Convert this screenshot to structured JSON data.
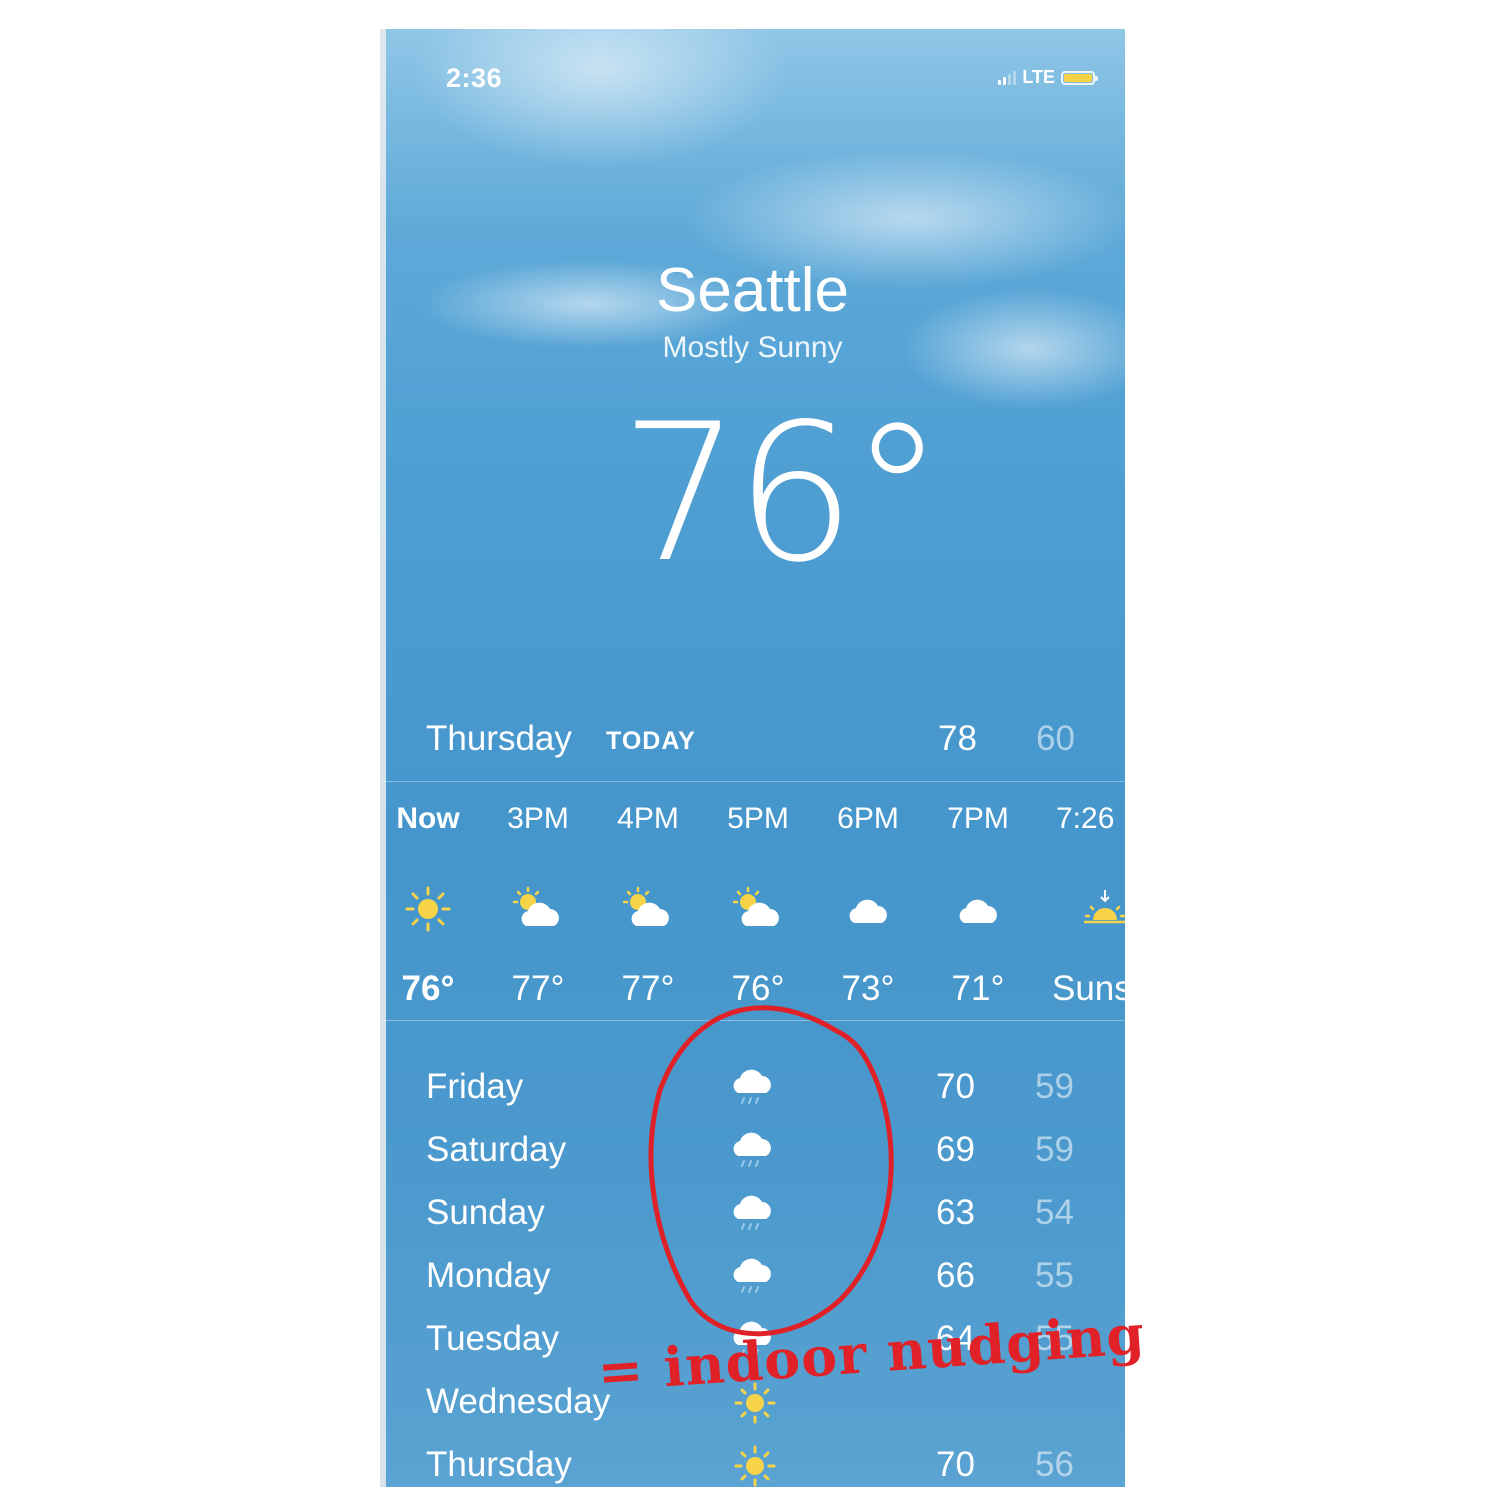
{
  "status_bar": {
    "time": "2:36",
    "network": "LTE"
  },
  "header": {
    "city": "Seattle",
    "condition": "Mostly Sunny",
    "temperature": "76°"
  },
  "today": {
    "day": "Thursday",
    "tag": "TODAY",
    "high": "78",
    "low": "60"
  },
  "hourly": [
    {
      "label": "Now",
      "icon": "sun-icon",
      "temp": "76°"
    },
    {
      "label": "3PM",
      "icon": "partly-cloudy-icon",
      "temp": "77°"
    },
    {
      "label": "4PM",
      "icon": "partly-cloudy-icon",
      "temp": "77°"
    },
    {
      "label": "5PM",
      "icon": "partly-cloudy-icon",
      "temp": "76°"
    },
    {
      "label": "6PM",
      "icon": "cloud-icon",
      "temp": "73°"
    },
    {
      "label": "7PM",
      "icon": "cloud-icon",
      "temp": "71°"
    },
    {
      "label": "7:26",
      "icon": "sunset-icon",
      "temp": "Suns"
    }
  ],
  "daily": [
    {
      "day": "Friday",
      "icon": "rain-icon",
      "high": "70",
      "low": "59"
    },
    {
      "day": "Saturday",
      "icon": "rain-icon",
      "high": "69",
      "low": "59"
    },
    {
      "day": "Sunday",
      "icon": "rain-icon",
      "high": "63",
      "low": "54"
    },
    {
      "day": "Monday",
      "icon": "rain-icon",
      "high": "66",
      "low": "55"
    },
    {
      "day": "Tuesday",
      "icon": "rain-icon",
      "high": "64",
      "low": "55"
    },
    {
      "day": "Wednesday",
      "icon": "sun-icon",
      "high": "",
      "low": ""
    },
    {
      "day": "Thursday",
      "icon": "sun-icon",
      "high": "70",
      "low": "56"
    }
  ],
  "annotation": {
    "text": "= indoor nudging",
    "color": "#e02228"
  },
  "colors": {
    "sky": "#4596cc",
    "sun": "#f7d348"
  }
}
